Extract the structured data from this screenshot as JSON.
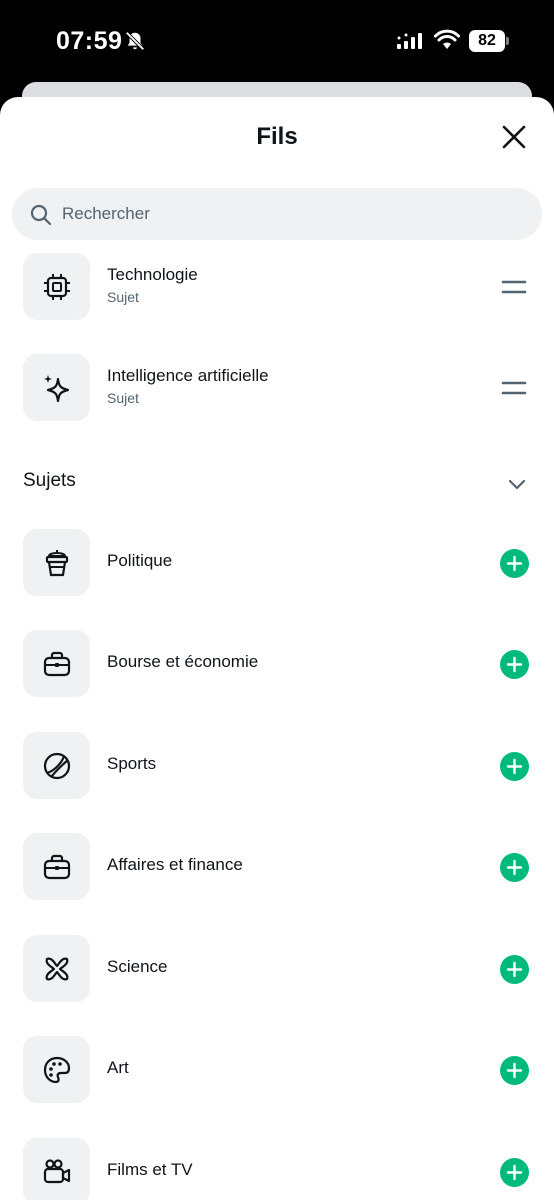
{
  "status_bar": {
    "time": "07:59",
    "battery": "82",
    "icons": [
      "bell-muted-icon",
      "signal-icon",
      "wifi-icon",
      "battery-icon"
    ]
  },
  "sheet": {
    "title": "Fils",
    "close_icon": "close-icon"
  },
  "search": {
    "placeholder": "Rechercher",
    "value": "",
    "icon": "search-icon"
  },
  "pinned": [
    {
      "label": "Technologie",
      "sub": "Sujet",
      "icon": "chip-icon",
      "action_icon": "drag-handle-icon"
    },
    {
      "label": "Intelligence artificielle",
      "sub": "Sujet",
      "icon": "sparkle-icon",
      "action_icon": "drag-handle-icon"
    }
  ],
  "section": {
    "title": "Sujets",
    "icon": "chevron-down-icon"
  },
  "topics": [
    {
      "label": "Politique",
      "icon": "podium-icon",
      "action_icon": "add-icon"
    },
    {
      "label": "Bourse et économie",
      "icon": "briefcase-icon",
      "action_icon": "add-icon"
    },
    {
      "label": "Sports",
      "icon": "tennis-ball-icon",
      "action_icon": "add-icon"
    },
    {
      "label": "Affaires et finance",
      "icon": "briefcase-icon",
      "action_icon": "add-icon"
    },
    {
      "label": "Science",
      "icon": "atom-icon",
      "action_icon": "add-icon"
    },
    {
      "label": "Art",
      "icon": "palette-icon",
      "action_icon": "add-icon"
    },
    {
      "label": "Films et TV",
      "icon": "video-camera-icon",
      "action_icon": "add-icon"
    }
  ],
  "colors": {
    "add_button": "#00ba7c",
    "tile_background": "#eff1f3",
    "text_primary": "#0f1419",
    "text_secondary": "#536471"
  }
}
